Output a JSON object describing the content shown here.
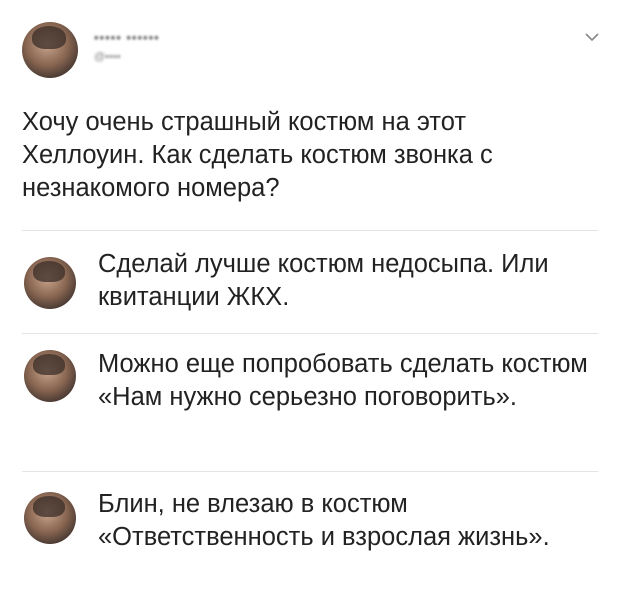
{
  "post": {
    "author_name": "••••• ••••••",
    "author_handle": "@••••",
    "text": "Хочу очень страшный костюм на этот Хеллоуин. Как сделать костюм звонка с незнакомого номера?"
  },
  "replies": [
    {
      "text": "Сделай лучше костюм недосыпа. Или квитанции ЖКХ."
    },
    {
      "text": "Можно еще попробовать сделать костюм «Нам нужно серьезно поговорить»."
    },
    {
      "text": "Блин, не влезаю в костюм «Ответственность и взрослая жизнь»."
    }
  ],
  "icons": {
    "menu": "chevron-down-icon"
  },
  "colors": {
    "text": "#222222",
    "divider": "#e4e4e4",
    "background": "#ffffff"
  }
}
